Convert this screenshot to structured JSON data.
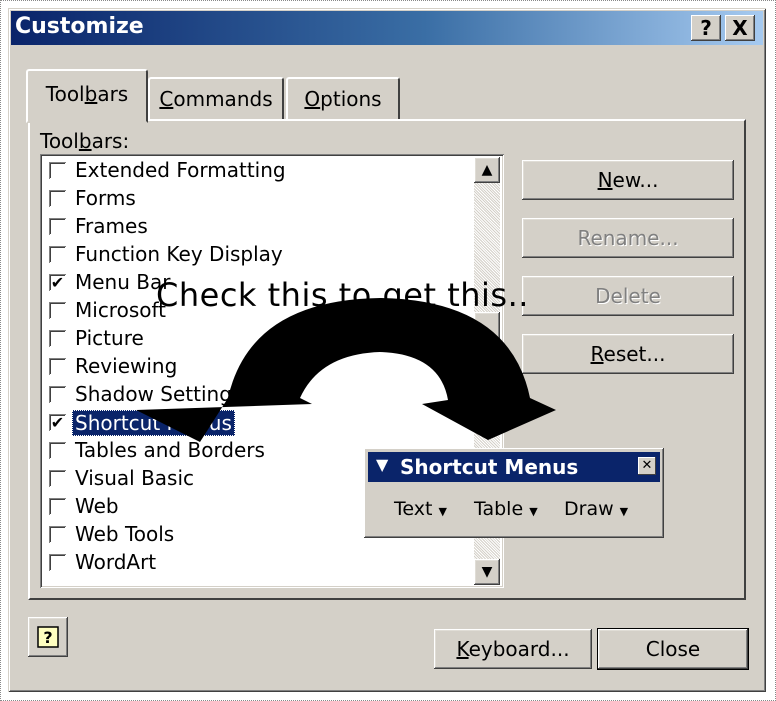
{
  "window": {
    "title": "Customize",
    "help_btn": "?",
    "close_btn": "X"
  },
  "tabs": [
    {
      "pre": "Tool",
      "u": "b",
      "post": "ars"
    },
    {
      "pre": "",
      "u": "C",
      "post": "ommands"
    },
    {
      "pre": "",
      "u": "O",
      "post": "ptions"
    }
  ],
  "list_label": {
    "pre": "Tool",
    "u": "b",
    "post": "ars:"
  },
  "toolbars": [
    {
      "label": "Extended Formatting",
      "checked": false
    },
    {
      "label": "Forms",
      "checked": false
    },
    {
      "label": "Frames",
      "checked": false
    },
    {
      "label": "Function Key Display",
      "checked": false
    },
    {
      "label": "Menu Bar",
      "checked": true
    },
    {
      "label": "Microsoft",
      "checked": false
    },
    {
      "label": "Picture",
      "checked": false
    },
    {
      "label": "Reviewing",
      "checked": false
    },
    {
      "label": "Shadow Settings",
      "checked": false
    },
    {
      "label": "Shortcut Menus",
      "checked": true,
      "selected": true
    },
    {
      "label": "Tables and Borders",
      "checked": false
    },
    {
      "label": "Visual Basic",
      "checked": false
    },
    {
      "label": "Web",
      "checked": false
    },
    {
      "label": "Web Tools",
      "checked": false
    },
    {
      "label": "WordArt",
      "checked": false
    }
  ],
  "side_buttons": {
    "new": {
      "u": "N",
      "post": "ew..."
    },
    "rename": "Rename...",
    "delete": "Delete",
    "reset": {
      "u": "R",
      "post": "eset..."
    }
  },
  "bottom": {
    "keyboard": {
      "u": "K",
      "post": "eyboard..."
    },
    "close": "Close"
  },
  "annotation": "Check this to get this..",
  "floating_toolbar": {
    "title": "Shortcut Menus",
    "items": [
      "Text",
      "Table",
      "Draw"
    ]
  },
  "icons": {
    "help": "help-icon",
    "checkmark": "checkmark-icon",
    "scroll_up": "arrow-up-icon",
    "scroll_down": "arrow-down-icon",
    "dropdown": "triangle-down-icon"
  },
  "colors": {
    "title_bar_start": "#0a246a",
    "title_bar_end": "#a6caf0",
    "face": "#d4d0c8",
    "selection": "#0a246a"
  }
}
